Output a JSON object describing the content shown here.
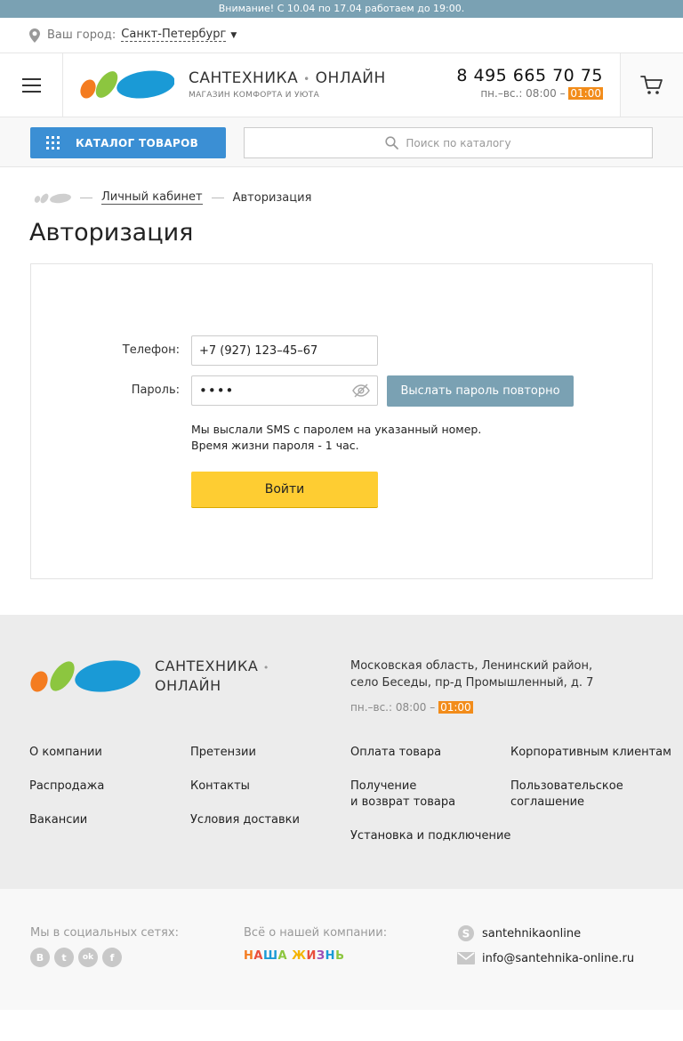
{
  "notice": "Внимание! С 10.04 по 17.04 работаем до 19:00.",
  "citybar": {
    "label": "Ваш город:",
    "city": "Санкт-Петербург"
  },
  "header": {
    "logo_title": "САНТЕХНИКА",
    "logo_title_2": "ОНЛАЙН",
    "logo_sub": "МАГАЗИН КОМФОРТА И УЮТА",
    "phone": "8 495 665 70 75",
    "hours_prefix": "пн.–вс.: 08:00 –",
    "hours_highlight": "01:00"
  },
  "toolbar": {
    "catalog_label": "КАТАЛОГ ТОВАРОВ",
    "search_placeholder": "Поиск по каталогу"
  },
  "breadcrumbs": {
    "items": [
      "Личный кабинет",
      "Авторизация"
    ]
  },
  "page_title": "Авторизация",
  "form": {
    "phone_label": "Телефон:",
    "phone_value": "+7 (927) 123–45–67",
    "password_label": "Пароль:",
    "password_value": "••••",
    "resend_label": "Выслать пароль повторно",
    "note_line1": "Мы выслали SMS с паролем на указанный номер.",
    "note_line2": "Время жизни пароля - 1 час.",
    "login_label": "Войти"
  },
  "footer": {
    "logo_line1": "САНТЕХНИКА",
    "logo_line2": "ОНЛАЙН",
    "address_line1": "Московская область, Ленинский район,",
    "address_line2": "село Беседы, пр-д Промышленный, д. 7",
    "hours_prefix": "пн.–вс.: 08:00 –",
    "hours_highlight": "01:00",
    "col1": [
      "О компании",
      "Распродажа",
      "Вакансии"
    ],
    "col2": [
      "Претензии",
      "Контакты",
      "Условия доставки"
    ],
    "col3": [
      "Оплата товара",
      "Получение",
      "и возврат товара",
      "Установка и подключение"
    ],
    "col4": [
      "Корпоративным клиентам",
      "Пользовательское",
      "соглашение"
    ]
  },
  "bottom": {
    "social_label": "Мы в социальных сетях:",
    "socials": [
      "В",
      "t",
      "ok",
      "f"
    ],
    "about_label": "Всё о нашей компании:",
    "nash": [
      "Н",
      "А",
      "Ш",
      "А",
      " ",
      "Ж",
      "И",
      "З",
      "Н",
      "Ь"
    ],
    "skype": "santehnikaonline",
    "email": "info@santehnika-online.ru"
  },
  "colors": {
    "accent_blue": "#3b8fd4",
    "notice_bg": "#7aa1b3",
    "hours_highlight": "#f28c1a",
    "login_button": "#fecd32",
    "logo_orange": "#f47c20",
    "logo_green": "#8cc63f",
    "logo_blue": "#1a9ad6"
  }
}
